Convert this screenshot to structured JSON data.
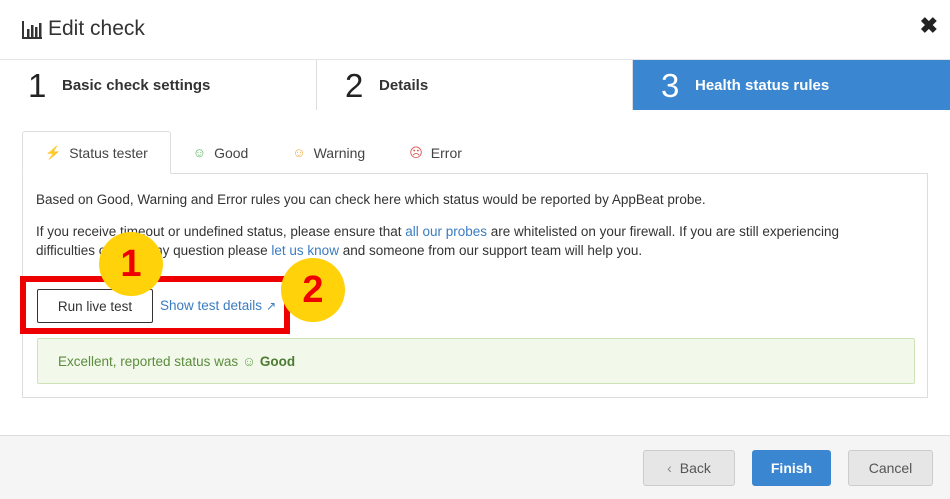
{
  "dialog": {
    "title": "Edit check",
    "close_symbol": "✖"
  },
  "steps": [
    {
      "number": "1",
      "label": "Basic check settings",
      "active": false
    },
    {
      "number": "2",
      "label": "Details",
      "active": false
    },
    {
      "number": "3",
      "label": "Health status rules",
      "active": true
    }
  ],
  "tabs": [
    {
      "icon": "bolt-icon",
      "glyph": "⚡",
      "label": "Status tester",
      "active": true
    },
    {
      "icon": "smile-icon",
      "glyph": "☺",
      "label": "Good",
      "color": "#5cb85c"
    },
    {
      "icon": "meh-icon",
      "glyph": "☺",
      "label": "Warning",
      "color": "#f0ad4e"
    },
    {
      "icon": "frown-icon",
      "glyph": "☹",
      "label": "Error",
      "color": "#d9534f"
    }
  ],
  "panel": {
    "intro": "Based on Good, Warning and Error rules you can check here which status would be reported by AppBeat probe.",
    "line2_a": "If you receive timeout or undefined status, please ensure that ",
    "line2_link": "all our probes",
    "line2_b": " are whitelisted on your firewall. If you are still experiencing",
    "line3_a": "difficulties or have any question please ",
    "line3_link": "let us know",
    "line3_b": " and someone from our support team will help you.",
    "run_button": "Run live test",
    "details_link": "Show test details",
    "result_text": "Excellent, reported status was",
    "result_status": "Good"
  },
  "annotations": {
    "badge1": "1",
    "badge2": "2"
  },
  "footer": {
    "back": "Back",
    "finish": "Finish",
    "cancel": "Cancel"
  },
  "colors": {
    "accent": "#3b86d0",
    "annotation_red": "#ee0000",
    "annotation_yellow": "#ffd20a"
  }
}
